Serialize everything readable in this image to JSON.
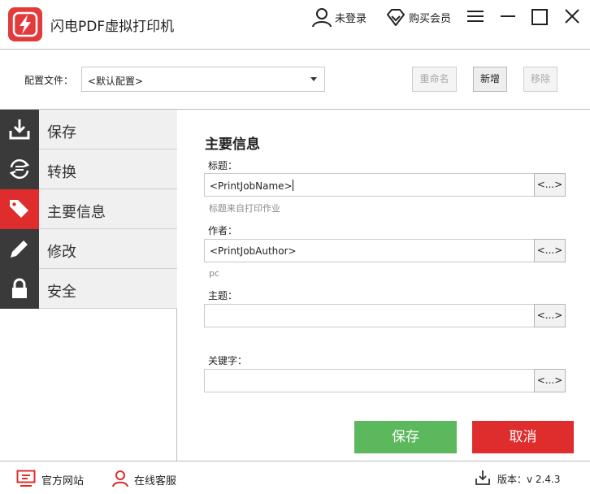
{
  "app": {
    "title": "闪电PDF虚拟打印机"
  },
  "titlebar": {
    "login": "未登录",
    "vip": "购买会员"
  },
  "config": {
    "label": "配置文件：",
    "selected": "<默认配置>",
    "rename": "重命名",
    "add": "新增",
    "remove": "移除"
  },
  "sidebar": {
    "items": [
      {
        "label": "保存",
        "icon": "download-icon"
      },
      {
        "label": "转换",
        "icon": "convert-icon"
      },
      {
        "label": "主要信息",
        "icon": "tags-icon",
        "active": true
      },
      {
        "label": "修改",
        "icon": "pencil-icon"
      },
      {
        "label": "安全",
        "icon": "lock-icon"
      }
    ]
  },
  "main": {
    "section_title": "主要信息",
    "title_label": "标题：",
    "title_value": "<PrintJobName>",
    "title_hint": "标题来自打印作业",
    "author_label": "作者：",
    "author_value": "<PrintJobAuthor>",
    "author_hint": "pc",
    "subject_label": "主题：",
    "subject_value": "",
    "keywords_label": "关键字：",
    "keywords_value": "",
    "token_button": "<...>"
  },
  "actions": {
    "save": "保存",
    "cancel": "取消"
  },
  "footer": {
    "website": "官方网站",
    "service": "在线客服",
    "version": "版本：v 2.4.3"
  },
  "colors": {
    "accent_red": "#df2c2c",
    "save_green": "#5cb85c",
    "sidebar_dark": "#3a3a3a"
  }
}
